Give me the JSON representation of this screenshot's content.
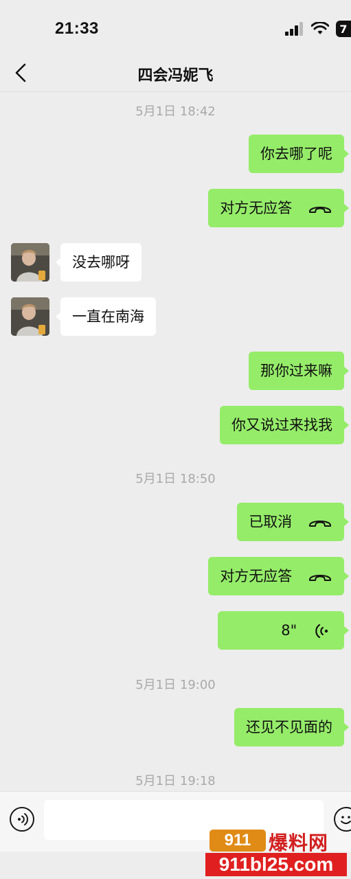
{
  "status_bar": {
    "time": "21:33",
    "battery_text": "7"
  },
  "header": {
    "title": "四会冯妮飞"
  },
  "timestamps": [
    "5月1日 18:42",
    "5月1日 18:50",
    "5月1日 19:00",
    "5月1日 19:18"
  ],
  "messages": [
    {
      "from": "me",
      "type": "text",
      "text": "你去哪了呢"
    },
    {
      "from": "me",
      "type": "call",
      "text": "对方无应答",
      "icon": "phone-hangup-icon"
    },
    {
      "from": "other",
      "type": "text",
      "text": "没去哪呀"
    },
    {
      "from": "other",
      "type": "text",
      "text": "一直在南海"
    },
    {
      "from": "me",
      "type": "text",
      "text": "那你过来嘛"
    },
    {
      "from": "me",
      "type": "text",
      "text": "你又说过来找我"
    },
    {
      "from": "me",
      "type": "call",
      "text": "已取消",
      "icon": "phone-hangup-icon"
    },
    {
      "from": "me",
      "type": "call",
      "text": "对方无应答",
      "icon": "phone-hangup-icon"
    },
    {
      "from": "me",
      "type": "voice",
      "duration": "8\"",
      "icon": "voice-wave-icon"
    },
    {
      "from": "me",
      "type": "text",
      "text": "还见不见面的"
    }
  ],
  "input_bar": {
    "voice_icon": "voice-toggle-icon",
    "emoji_icon": "emoji-icon"
  },
  "watermark": {
    "logo": "911",
    "cn": "爆料网",
    "url": "911bl25.com"
  },
  "colors": {
    "outgoing_bubble": "#95ec69",
    "incoming_bubble": "#ffffff",
    "background": "#ededed"
  }
}
